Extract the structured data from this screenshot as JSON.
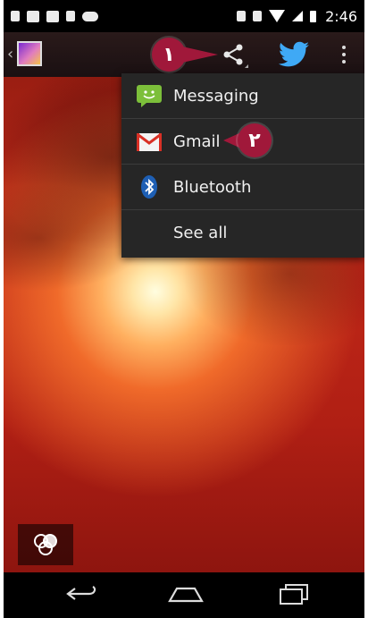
{
  "status_bar": {
    "time": "2:46"
  },
  "share_menu": {
    "items": [
      {
        "label": "Messaging",
        "icon": "messaging-icon"
      },
      {
        "label": "Gmail",
        "icon": "gmail-icon"
      },
      {
        "label": "Bluetooth",
        "icon": "bluetooth-icon"
      },
      {
        "label": "See all",
        "icon": ""
      }
    ]
  },
  "callouts": [
    {
      "text": "١"
    },
    {
      "text": "٢"
    }
  ],
  "colors": {
    "callout": "#a0183a",
    "menu_bg": "#262626",
    "twitter": "#1da1f2"
  }
}
